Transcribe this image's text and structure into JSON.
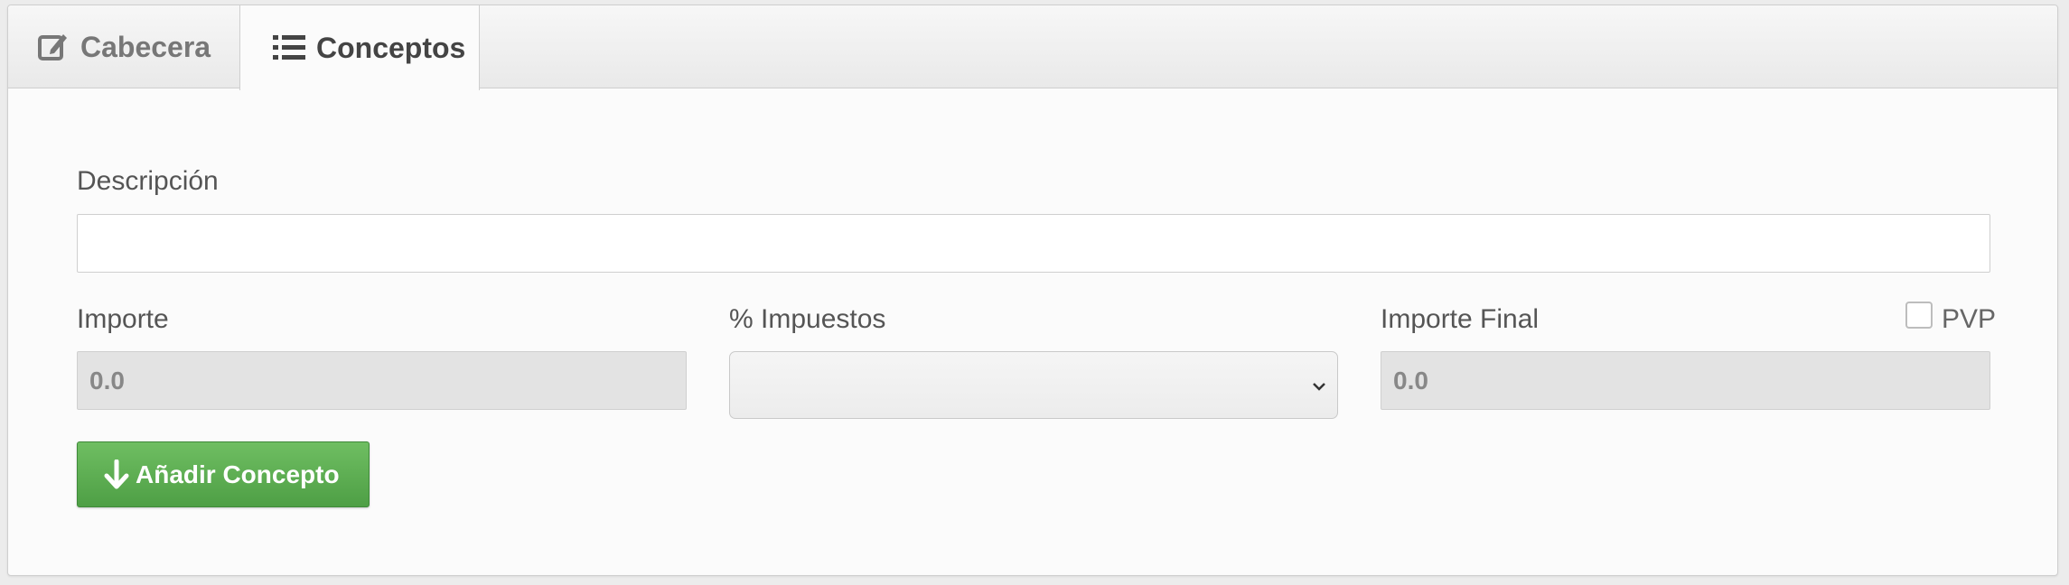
{
  "tabs": [
    {
      "label": "Cabecera",
      "icon": "edit-icon"
    },
    {
      "label": "Conceptos",
      "icon": "list-icon",
      "active": true
    }
  ],
  "form": {
    "descripcion_label": "Descripción",
    "descripcion_value": "",
    "importe_label": "Importe",
    "importe_value": "0.0",
    "impuestos_label": "% Impuestos",
    "impuestos_selected": "",
    "importe_final_label": "Importe Final",
    "importe_final_value": "0.0",
    "pvp_label": "PVP",
    "pvp_checked": false
  },
  "actions": {
    "add_label": "Añadir Concepto",
    "add_icon": "arrow-down-icon"
  },
  "colors": {
    "button_green": "#5cae52",
    "readonly_bg": "#e3e3e3"
  }
}
